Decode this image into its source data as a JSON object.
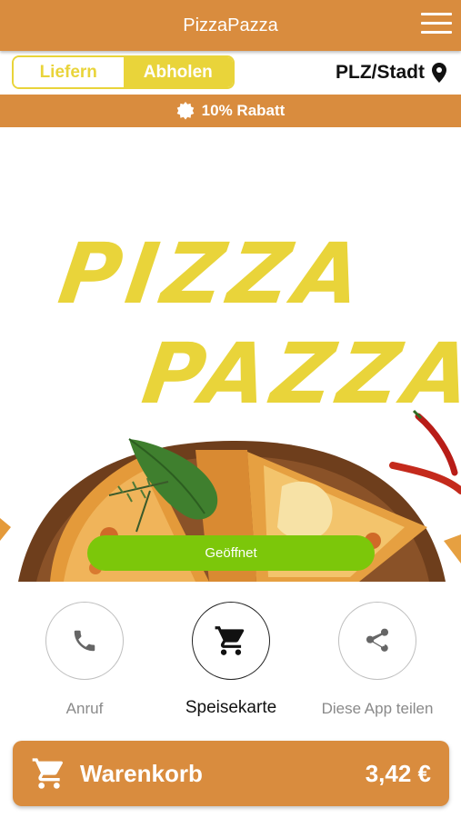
{
  "header": {
    "title": "PizzaPazza",
    "menu_icon": "hamburger-menu-icon"
  },
  "mode_toggle": {
    "options": [
      "Liefern",
      "Abholen"
    ],
    "selected": "Abholen"
  },
  "location": {
    "label": "PLZ/Stadt",
    "icon": "location-pin-icon"
  },
  "discount": {
    "label": "10% Rabatt",
    "icon": "badge-icon"
  },
  "hero": {
    "brand_line_1": "PIZZA",
    "brand_line_2": "PAZZA"
  },
  "status": {
    "label": "Geöffnet"
  },
  "actions": [
    {
      "label": "Anruf",
      "icon": "phone-icon"
    },
    {
      "label": "Speisekarte",
      "icon": "cart-icon",
      "active": true
    },
    {
      "label": "Diese App teilen",
      "icon": "share-icon"
    }
  ],
  "cart": {
    "label": "Warenkorb",
    "amount": "3,42 €",
    "icon": "cart-icon"
  },
  "colors": {
    "accent": "#d98c3e",
    "yellow": "#e9d43a",
    "open_green": "#7cc70a"
  }
}
